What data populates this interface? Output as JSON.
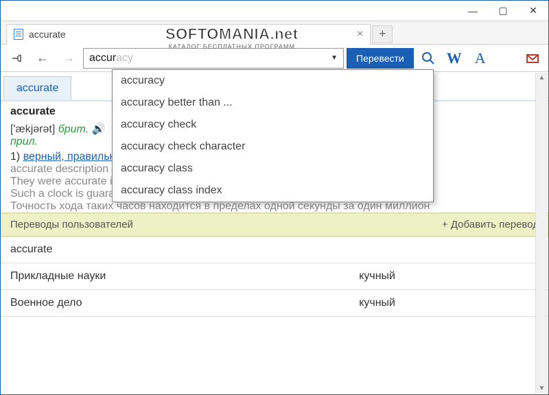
{
  "tab": {
    "label": "accurate"
  },
  "search": {
    "typed": "accur",
    "ghost": "accuracy",
    "translate_btn": "Перевести"
  },
  "suggestions": [
    "accuracy",
    "accuracy better than ...",
    "accuracy check",
    "accuracy check character",
    "accuracy class",
    "accuracy class index"
  ],
  "lex_tab": "accurate",
  "entry": {
    "head": "accurate",
    "phon": "['ækjərət]",
    "brit": "брит.",
    "pos": "прил.",
    "sense_num": "1)",
    "sense_links": "верный, правильный",
    "line2": "accurate description — точное описание",
    "line3": "They were accurate in their prediction. — Они оказались правы в своих прогнозах.",
    "line4": "Such a clock is guaranteed to be accurate within one second in one million years. —",
    "line5": "Точность хода таких часов находится в пределах одной секунды за один миллион"
  },
  "user_tr": {
    "header": "Переводы пользователей",
    "add": "+  Добавить перевод",
    "rows": [
      {
        "c1": "accurate",
        "c2": ""
      },
      {
        "c1": "Прикладные науки",
        "c2": "кучный"
      },
      {
        "c1": "Военное дело",
        "c2": "кучный"
      }
    ]
  },
  "watermark": {
    "l1": "SOFTOMANIA.net",
    "l2": "КАТАЛОГ БЕСПЛАТНЫХ ПРОГРАММ"
  }
}
